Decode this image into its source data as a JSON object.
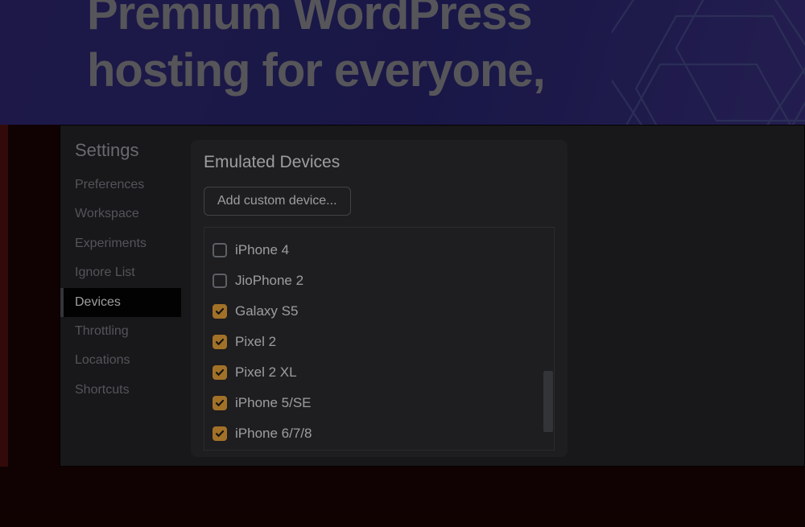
{
  "banner": {
    "headline_line1": "Premium WordPress",
    "headline_line2": "hosting for everyone,"
  },
  "sidebar": {
    "title": "Settings",
    "items": [
      {
        "label": "Preferences",
        "active": false
      },
      {
        "label": "Workspace",
        "active": false
      },
      {
        "label": "Experiments",
        "active": false
      },
      {
        "label": "Ignore List",
        "active": false
      },
      {
        "label": "Devices",
        "active": true
      },
      {
        "label": "Throttling",
        "active": false
      },
      {
        "label": "Locations",
        "active": false
      },
      {
        "label": "Shortcuts",
        "active": false
      }
    ]
  },
  "panel": {
    "title": "Emulated Devices",
    "add_button": "Add custom device...",
    "devices": [
      {
        "label": "iPhone 4",
        "checked": false
      },
      {
        "label": "JioPhone 2",
        "checked": false
      },
      {
        "label": "Galaxy S5",
        "checked": true
      },
      {
        "label": "Pixel 2",
        "checked": true
      },
      {
        "label": "Pixel 2 XL",
        "checked": true
      },
      {
        "label": "iPhone 5/SE",
        "checked": true
      },
      {
        "label": "iPhone 6/7/8",
        "checked": true
      }
    ]
  },
  "colors": {
    "checkbox_checked": "#f2a93b",
    "panel_bg": "#292a2d",
    "devtools_bg": "#202124"
  }
}
